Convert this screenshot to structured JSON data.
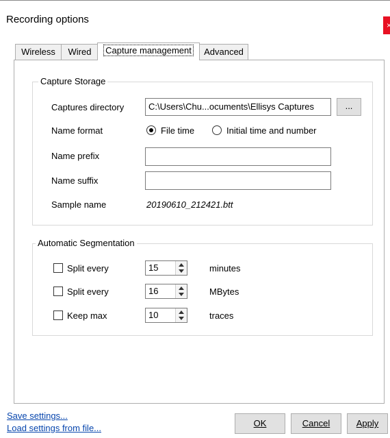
{
  "window": {
    "title": "Recording options",
    "close_label": "×"
  },
  "tabs": [
    {
      "label": "Wireless"
    },
    {
      "label": "Wired"
    },
    {
      "label": "Capture management"
    },
    {
      "label": "Advanced"
    }
  ],
  "capture_storage": {
    "legend": "Capture Storage",
    "directory_label": "Captures directory",
    "directory_value": "C:\\Users\\Chu...ocuments\\Ellisys Captures",
    "browse_label": "...",
    "name_format_label": "Name format",
    "format_file_time": "File time",
    "format_initial_time": "Initial time and number",
    "name_prefix_label": "Name prefix",
    "name_prefix_value": "",
    "name_suffix_label": "Name suffix",
    "name_suffix_value": "",
    "sample_name_label": "Sample name",
    "sample_name_value": "20190610_212421.btt"
  },
  "segmentation": {
    "legend": "Automatic Segmentation",
    "rows": [
      {
        "label": "Split every",
        "value": "15",
        "unit": "minutes",
        "checked": false
      },
      {
        "label": "Split every",
        "value": "16",
        "unit": "MBytes",
        "checked": false
      },
      {
        "label": "Keep max",
        "value": "10",
        "unit": "traces",
        "checked": false
      }
    ]
  },
  "footer": {
    "save_link": "Save settings...",
    "load_link": "Load settings from file...",
    "ok_label": "OK",
    "cancel_label": "Cancel",
    "apply_label": "Apply"
  }
}
